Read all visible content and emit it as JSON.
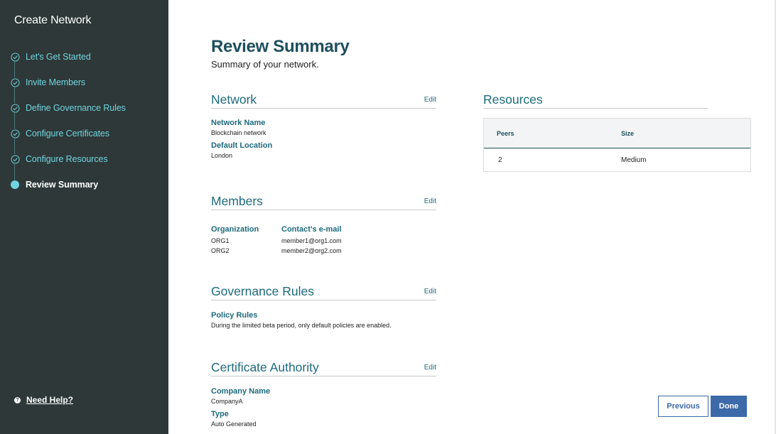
{
  "sidebar": {
    "title": "Create Network",
    "steps": [
      {
        "label": "Let's Get Started",
        "state": "done"
      },
      {
        "label": "Invite Members",
        "state": "done"
      },
      {
        "label": "Define Governance Rules",
        "state": "done"
      },
      {
        "label": "Configure Certificates",
        "state": "done"
      },
      {
        "label": "Configure Resources",
        "state": "done"
      },
      {
        "label": "Review Summary",
        "state": "current"
      }
    ],
    "help_label": "Need Help?",
    "help_icon": "?"
  },
  "page": {
    "title": "Review Summary",
    "subtitle": "Summary of your network."
  },
  "network": {
    "title": "Network",
    "edit": "Edit",
    "name_label": "Network Name",
    "name_value": "Blockchain network",
    "location_label": "Default Location",
    "location_value": "London"
  },
  "members": {
    "title": "Members",
    "edit": "Edit",
    "col_org": "Organization",
    "col_email": "Contact's e-mail",
    "rows": [
      {
        "org": "ORG1",
        "email": "member1@org1.com"
      },
      {
        "org": "ORG2",
        "email": "member2@org2.com"
      }
    ]
  },
  "governance": {
    "title": "Governance Rules",
    "edit": "Edit",
    "policy_label": "Policy Rules",
    "policy_value": "During the limited beta period, only default policies are enabled."
  },
  "certificate": {
    "title": "Certificate Authority",
    "edit": "Edit",
    "company_label": "Company Name",
    "company_value": "CompanyA",
    "type_label": "Type",
    "type_value": "Auto Generated"
  },
  "resources": {
    "title": "Resources",
    "col_peers": "Peers",
    "col_size": "Size",
    "rows": [
      {
        "peers": "2",
        "size": "Medium"
      }
    ]
  },
  "buttons": {
    "previous": "Previous",
    "done": "Done"
  },
  "colors": {
    "sidebar_bg": "#2e3838",
    "accent_teal": "#6fd4df",
    "heading": "#1d4f5c",
    "primary_button": "#3d6aa8"
  }
}
